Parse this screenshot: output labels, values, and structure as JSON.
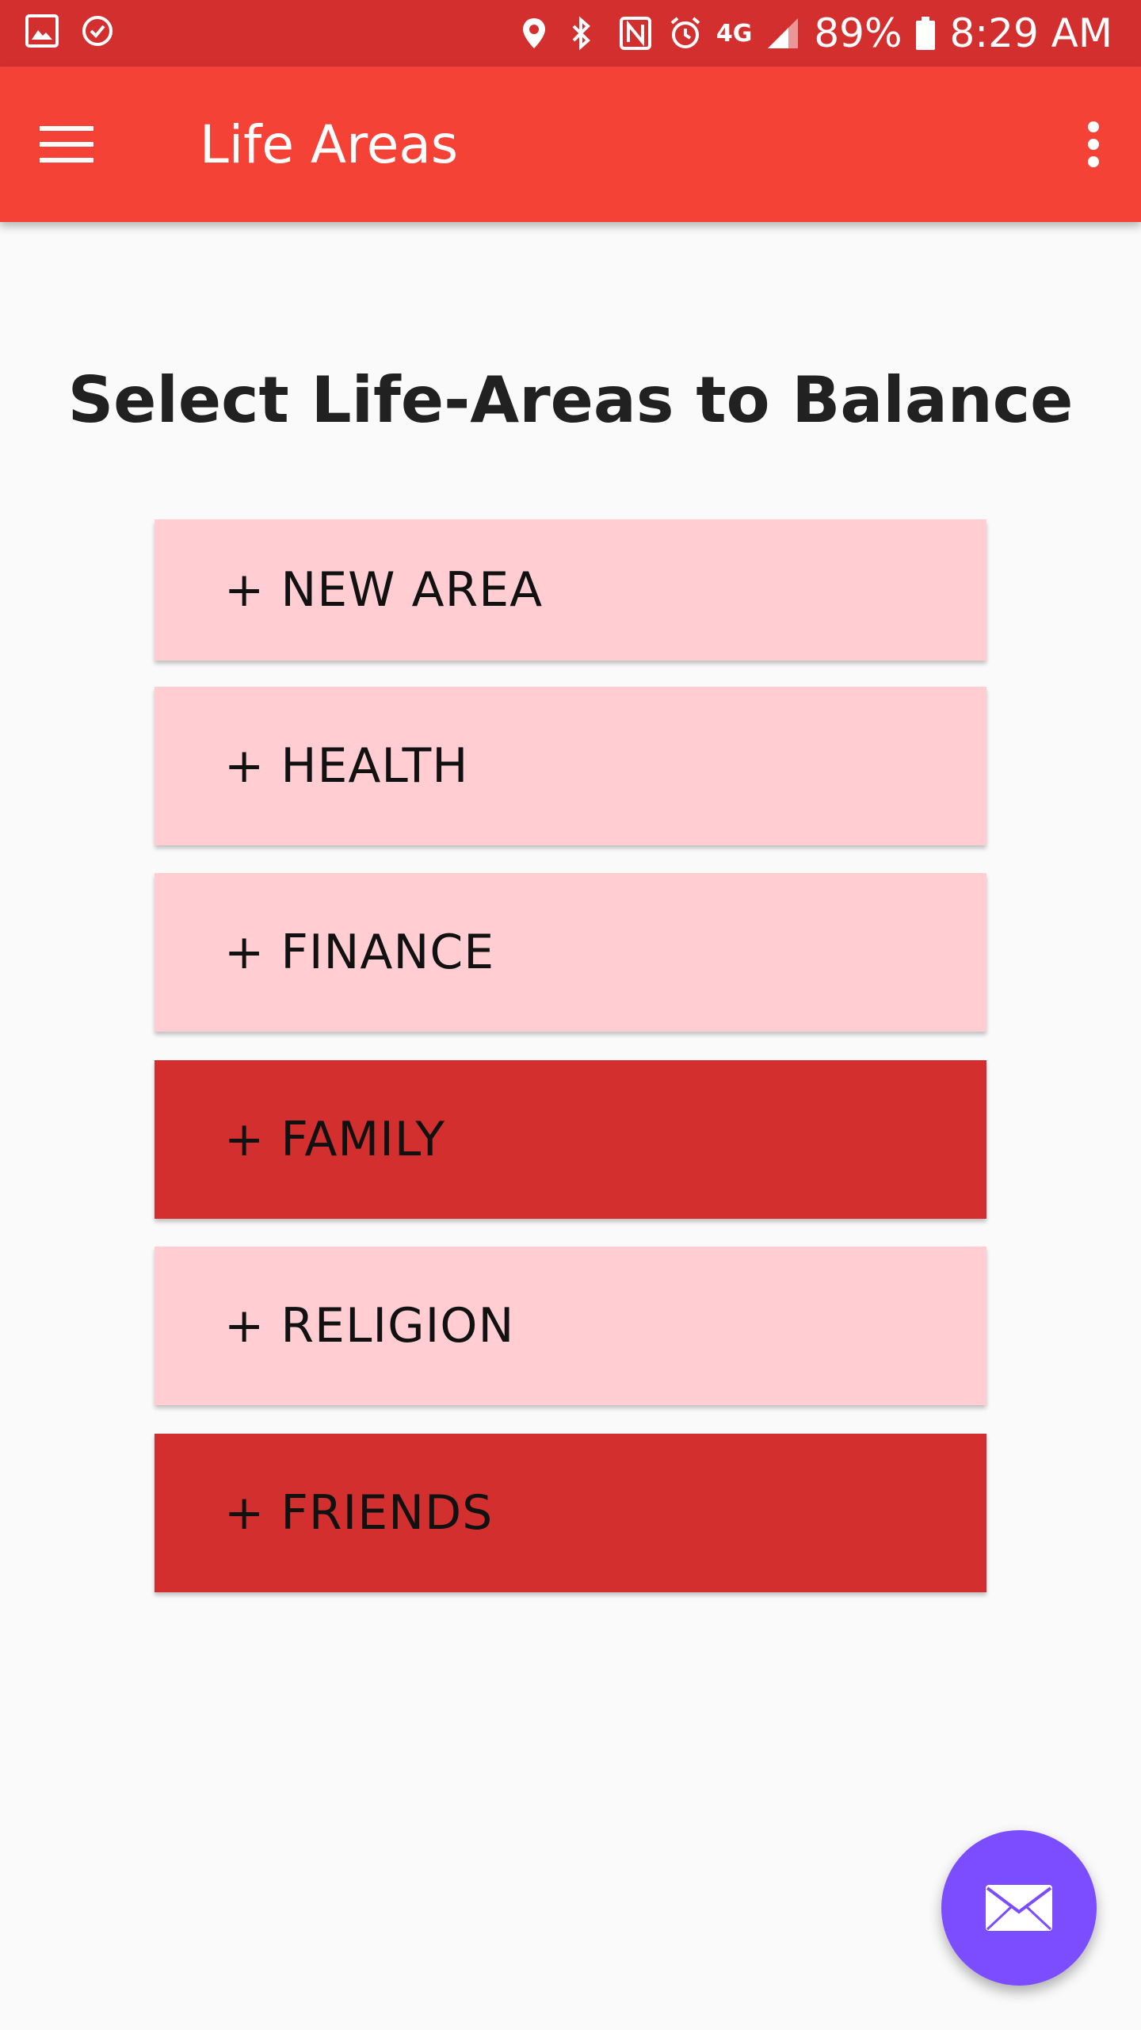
{
  "status_bar": {
    "battery": "89%",
    "time": "8:29 AM",
    "network": "4G",
    "icons_left": [
      "gallery-icon",
      "clock-check-icon"
    ],
    "icons_right": [
      "location-icon",
      "bluetooth-icon",
      "nfc-icon",
      "alarm-icon",
      "lte-icon",
      "signal-icon",
      "battery-icon"
    ]
  },
  "app_bar": {
    "title": "Life Areas",
    "menu_icon": "hamburger-menu-icon",
    "overflow_icon": "more-vert-icon"
  },
  "main": {
    "heading": "Select Life-Areas to Balance",
    "areas": [
      {
        "label": "+ NEW AREA",
        "selected": false
      },
      {
        "label": "+ HEALTH",
        "selected": false
      },
      {
        "label": "+ FINANCE",
        "selected": false
      },
      {
        "label": "+ FAMILY",
        "selected": true
      },
      {
        "label": "+ RELIGION",
        "selected": false
      },
      {
        "label": "+ FRIENDS",
        "selected": true
      }
    ]
  },
  "fab": {
    "icon": "mail-icon"
  },
  "colors": {
    "status_bar": "#d32f2f",
    "app_bar": "#f44336",
    "area_unselected": "#ffcdd2",
    "area_selected": "#d32f2f",
    "fab": "#7c4dff",
    "background": "#fafafa"
  }
}
